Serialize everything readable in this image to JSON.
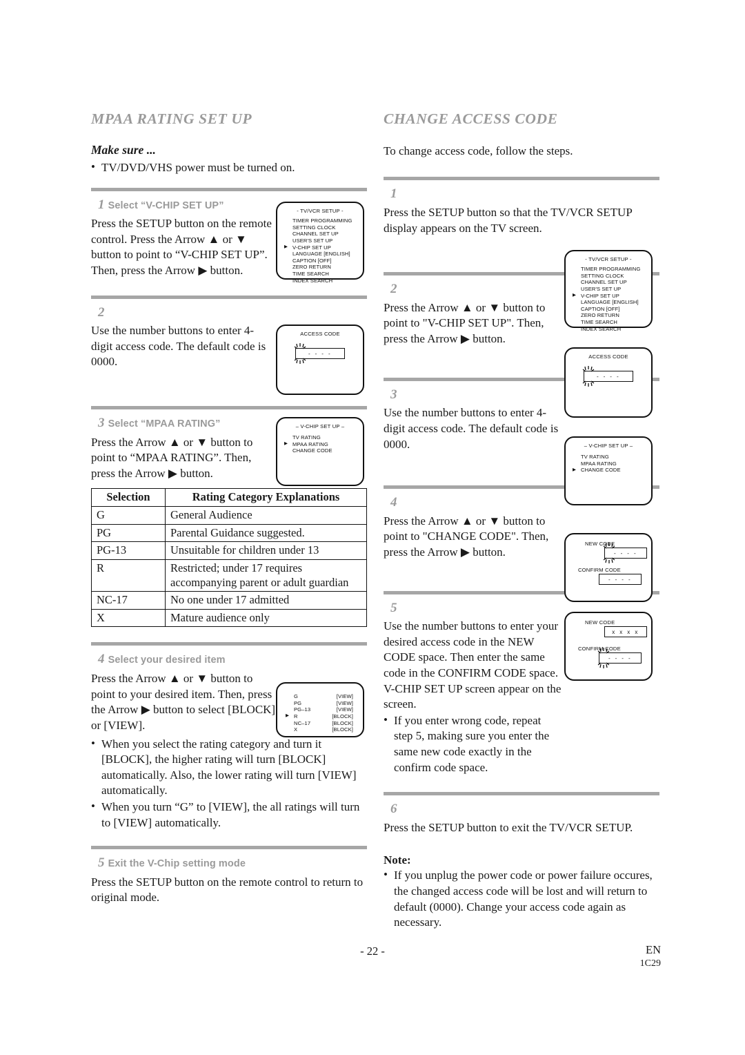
{
  "left": {
    "section_title": "MPAA RATING SET UP",
    "make_sure_label": "Make sure ...",
    "make_sure_bullet": "TV/DVD/VHS power must be turned on.",
    "steps": [
      {
        "num": "1",
        "title": "Select “V-CHIP SET UP”",
        "body_line1": "Press the SETUP button on the",
        "body_line2": "remote control.",
        "body_line3": "Press the Arrow ▲ or ▼ button to",
        "body_line4": "point to “V-CHIP SET UP”.",
        "body_line5": "Then, press the Arrow ▶ button."
      },
      {
        "num": "2",
        "title": "",
        "body_line1": "Use the number buttons to enter 4-",
        "body_line2": "digit access code. The default code",
        "body_line3": "is 0000."
      },
      {
        "num": "3",
        "title": "Select “MPAA RATING”",
        "body_line1": "Press the Arrow ▲ or ▼ button to",
        "body_line2": "point to “MPAA RATING”.",
        "body_line3": "Then, press the Arrow ▶ button."
      },
      {
        "num": "4",
        "title": "Select your desired item",
        "body_line1": "Press the Arrow ▲ or ▼ button to",
        "body_line2": "point to your desired item.",
        "body_line3": "Then, press the Arrow ▶ button to",
        "body_line4": "select [BLOCK] or [VIEW].",
        "bullets": [
          "When you select the rating category and turn it [BLOCK], the higher rating will turn [BLOCK] automatically.  Also, the lower rating will turn [VIEW] automatically.",
          "When you turn “G” to [VIEW], the all ratings will turn to [VIEW] automatically."
        ]
      },
      {
        "num": "5",
        "title": "Exit the V-Chip setting mode",
        "body_line1": "Press the SETUP button on the remote control to",
        "body_line2": "return to original mode."
      }
    ],
    "table": {
      "headers": [
        "Selection",
        "Rating Category Explanations"
      ],
      "rows": [
        [
          "G",
          "General Audience"
        ],
        [
          "PG",
          "Parental Guidance suggested."
        ],
        [
          "PG-13",
          "Unsuitable for children under 13"
        ],
        [
          "R",
          "Restricted; under 17 requires accompanying parent or adult guardian"
        ],
        [
          "NC-17",
          "No one under 17 admitted"
        ],
        [
          "X",
          "Mature audience only"
        ]
      ]
    }
  },
  "right": {
    "section_title": "CHANGE ACCESS CODE",
    "intro": "To change access code, follow the steps.",
    "steps": [
      {
        "num": "1",
        "body_line1": "Press the SETUP button so that the TV/VCR SETUP",
        "body_line2": "display appears on the TV screen."
      },
      {
        "num": "2",
        "body_line1": "Press the Arrow ▲ or ▼ button to",
        "body_line2": "point to \"V-CHIP SET UP\". Then,",
        "body_line3": "press the Arrow ▶ button."
      },
      {
        "num": "3",
        "body_line1": "Use the number buttons to enter 4-",
        "body_line2": "digit access code. The default code",
        "body_line3": "is 0000."
      },
      {
        "num": "4",
        "body_line1": "Press the Arrow ▲ or ▼ button to",
        "body_line2": "point to \"CHANGE CODE\". Then,",
        "body_line3": "press the Arrow ▶ button."
      },
      {
        "num": "5",
        "body_line1": "Use the number buttons to enter",
        "body_line2": "your desired access code in the",
        "body_line3": "NEW CODE space. Then enter the",
        "body_line4": "same code in the CONFIRM",
        "body_line5": "CODE space. V-CHIP SET UP",
        "body_line6": "screen appear on the screen.",
        "bullet": "If you enter wrong code, repeat step 5, making sure you enter the same new code exactly in the confirm code space."
      },
      {
        "num": "6",
        "body_line1": "Press the SETUP button to exit the TV/VCR SETUP."
      }
    ],
    "note_label": "Note:",
    "note_bullet": "If you unplug the power code or power failure occures, the changed access code will be lost and will return to default (0000). Change your access code again as necessary."
  },
  "screens": {
    "tvvcr_setup": {
      "title": "- TV/VCR SETUP -",
      "items": [
        {
          "label": "TIMER PROGRAMMING",
          "selected": false
        },
        {
          "label": "SETTING CLOCK",
          "selected": false
        },
        {
          "label": "CHANNEL SET UP",
          "selected": false
        },
        {
          "label": "USER'S SET UP",
          "selected": false
        },
        {
          "label": "V-CHIP SET UP",
          "selected": true
        },
        {
          "label": "LANGUAGE  [ENGLISH]",
          "selected": false
        },
        {
          "label": "CAPTION  [OFF]",
          "selected": false
        },
        {
          "label": "ZERO RETURN",
          "selected": false
        },
        {
          "label": "TIME SEARCH",
          "selected": false
        },
        {
          "label": "INDEX SEARCH",
          "selected": false
        }
      ]
    },
    "access_code": {
      "title": "ACCESS CODE",
      "field_value": "- - - -"
    },
    "vchip_mpaa": {
      "title": "– V-CHIP SET UP –",
      "items": [
        {
          "label": "TV RATING",
          "selected": false
        },
        {
          "label": "MPAA RATING",
          "selected": true
        },
        {
          "label": "CHANGE CODE",
          "selected": false
        }
      ]
    },
    "vchip_change": {
      "title": "– V-CHIP SET UP –",
      "items": [
        {
          "label": "TV RATING",
          "selected": false
        },
        {
          "label": "MPAA RATING",
          "selected": false
        },
        {
          "label": "CHANGE CODE",
          "selected": true
        }
      ]
    },
    "mpaa_list": {
      "items": [
        {
          "label": "G",
          "value": "[VIEW]",
          "selected": false
        },
        {
          "label": "PG",
          "value": "[VIEW]",
          "selected": false
        },
        {
          "label": "PG–13",
          "value": "[VIEW]",
          "selected": false
        },
        {
          "label": "R",
          "value": "[BLOCK]",
          "selected": true
        },
        {
          "label": "NC–17",
          "value": "[BLOCK]",
          "selected": false
        },
        {
          "label": "X",
          "value": "[BLOCK]",
          "selected": false
        }
      ]
    },
    "new_code_blank": {
      "new_code_label": "NEW CODE",
      "new_code_value": "- - - -",
      "confirm_code_label": "CONFIRM CODE",
      "confirm_code_value": "- - - -"
    },
    "new_code_filled": {
      "new_code_label": "NEW CODE",
      "new_code_value": "x x x x",
      "confirm_code_label": "CONFIRM CODE",
      "confirm_code_value": "- - - -"
    }
  },
  "footer": {
    "page_number": "- 22 -",
    "language": "EN",
    "doc_code": "1C29"
  }
}
